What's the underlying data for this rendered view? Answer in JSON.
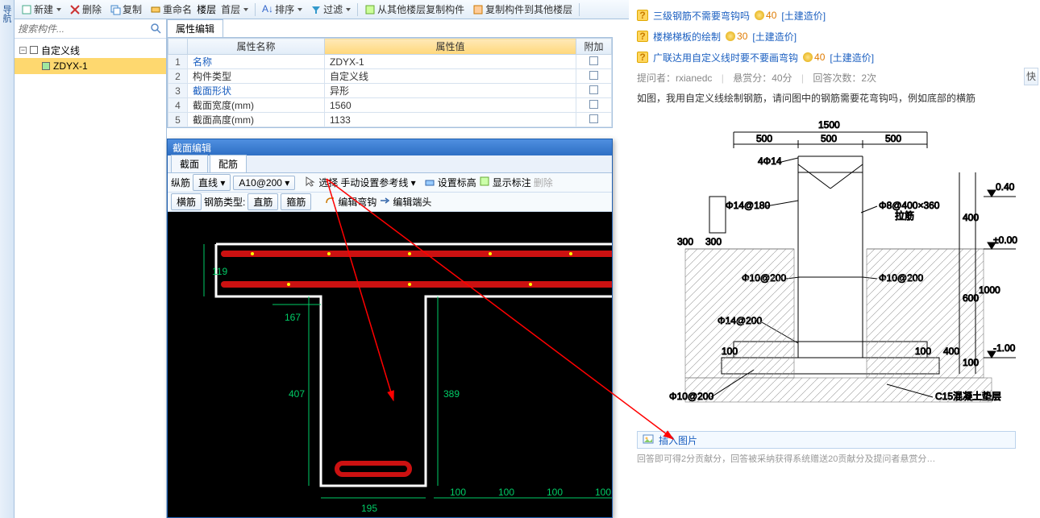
{
  "toolbar": {
    "new": "新建",
    "del": "删除",
    "copy": "复制",
    "rename": "重命名",
    "floor_lbl": "楼层",
    "floor_val": "首层",
    "sort": "排序",
    "filter": "过滤",
    "copy_from": "从其他楼层复制构件",
    "copy_to": "复制构件到其他楼层"
  },
  "left": {
    "vtab": "导航",
    "search_ph": "搜索构件...",
    "root": "自定义线",
    "child": "ZDYX-1"
  },
  "prop": {
    "tab": "属性编辑",
    "h_name": "属性名称",
    "h_val": "属性值",
    "h_ext": "附加",
    "rows": [
      {
        "i": "1",
        "n": "名称",
        "v": "ZDYX-1",
        "link": true
      },
      {
        "i": "2",
        "n": "构件类型",
        "v": "自定义线"
      },
      {
        "i": "3",
        "n": "截面形状",
        "v": "异形",
        "link": true
      },
      {
        "i": "4",
        "n": "截面宽度(mm)",
        "v": "1560"
      },
      {
        "i": "5",
        "n": "截面高度(mm)",
        "v": "1133"
      }
    ]
  },
  "sec": {
    "title": "截面编辑",
    "tab1": "截面",
    "tab2": "配筋",
    "tb1": {
      "long": "纵筋",
      "line": "直线",
      "spec": "A10@200",
      "sel": "选择",
      "ref": "手动设置参考线",
      "elev": "设置标高",
      "anno": "显示标注",
      "del": "删除"
    },
    "tb2": {
      "hb": "横筋",
      "type": "钢筋类型:",
      "straight": "直筋",
      "stirrup": "箍筋",
      "hook": "编辑弯钩",
      "end": "编辑端头"
    }
  },
  "cad": {
    "d119": "119",
    "d167": "167",
    "d407": "407",
    "d389": "389",
    "d195": "195",
    "d100": "100"
  },
  "right": {
    "q1": {
      "t": "三级钢筋不需要弯钩吗",
      "p": "40",
      "c": "[土建造价]"
    },
    "q2": {
      "t": "楼梯梯板的绘制",
      "p": "30",
      "c": "[土建造价]"
    },
    "q3": {
      "t": "广联达用自定义线时要不要画弯钩",
      "p": "40",
      "c": "[土建造价]"
    },
    "asker_lbl": "提问者：",
    "asker": "rxianedc",
    "bounty_lbl": "悬赏分：",
    "bounty": "40分",
    "ans_lbl": "回答次数：",
    "ans": "2次",
    "body": "如图，我用自定义线绘制钢筋，请问图中的钢筋需要花弯钩吗，例如底部的横筋",
    "insert": "插入图片",
    "foot": "回答即可得2分贡献分，回答被采纳获得系统赠送20贡献分及提问者悬赏分…",
    "side": "快"
  },
  "diagram": {
    "w1500": "1500",
    "w500": "500",
    "t4c14": "4Φ14",
    "t14_180": "Φ14@180",
    "t8_400": "Φ8@400×360",
    "lajin": "拉筋",
    "t10_200": "Φ10@200",
    "t14_200": "Φ14@200",
    "d300": "300",
    "d100": "100",
    "d400": "400",
    "d600": "600",
    "d1000": "1000",
    "e040": "0.40",
    "e000": "±0.00",
    "e_100": "-1.00",
    "c15": "C15混凝土垫层",
    "b10_200": "Φ10@200"
  }
}
